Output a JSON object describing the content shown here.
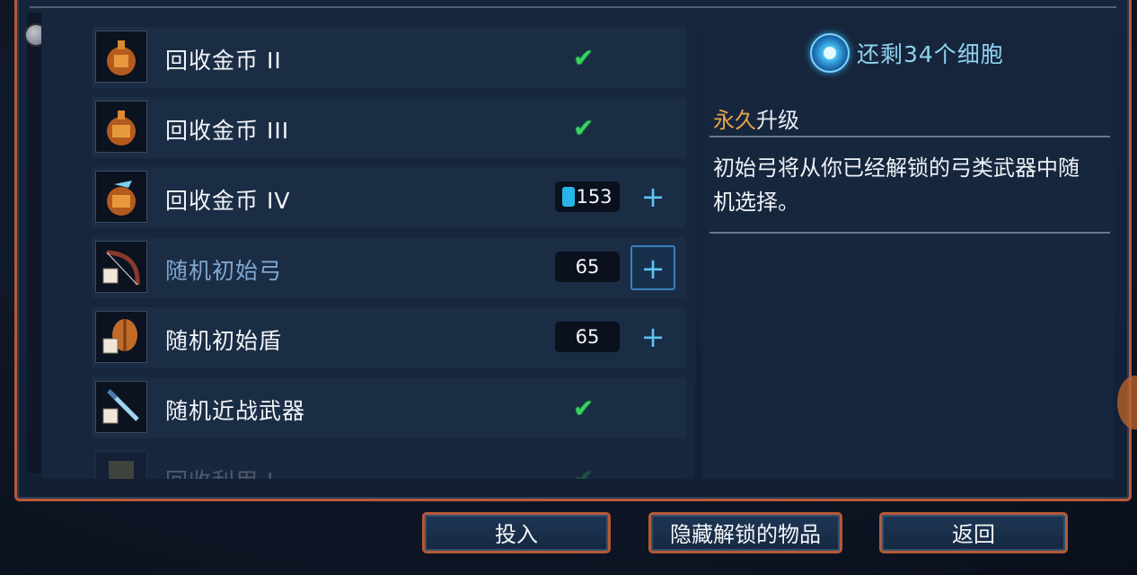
{
  "cells_remaining": "还剩34个细胞",
  "items": [
    {
      "label": "回收金币 II",
      "state": "owned",
      "icon": "gold-bag-ii-icon"
    },
    {
      "label": "回收金币 III",
      "state": "owned",
      "icon": "gold-bag-iii-icon"
    },
    {
      "label": "回收金币 IV",
      "state": "cost",
      "cost": "153",
      "icon": "gold-bag-iv-icon"
    },
    {
      "label": "随机初始弓",
      "state": "cost",
      "cost": "65",
      "selected": true,
      "icon": "random-bow-icon"
    },
    {
      "label": "随机初始盾",
      "state": "cost",
      "cost": "65",
      "icon": "random-shield-icon"
    },
    {
      "label": "随机近战武器",
      "state": "owned",
      "icon": "random-melee-icon"
    },
    {
      "label": "回收利用 I",
      "state": "owned",
      "faded": true,
      "icon": "recycle-icon"
    }
  ],
  "info": {
    "category_highlight": "永久",
    "category_rest": "升级",
    "description": "初始弓将从你已经解锁的弓类武器中随机选择。"
  },
  "buttons": {
    "invest": "投入",
    "hide_unlocked": "隐藏解锁的物品",
    "back": "返回"
  },
  "colors": {
    "frame": "#b55a35",
    "accent_blue": "#5fc3f0",
    "check_green": "#3bd060",
    "category_orange": "#e5a44a"
  }
}
